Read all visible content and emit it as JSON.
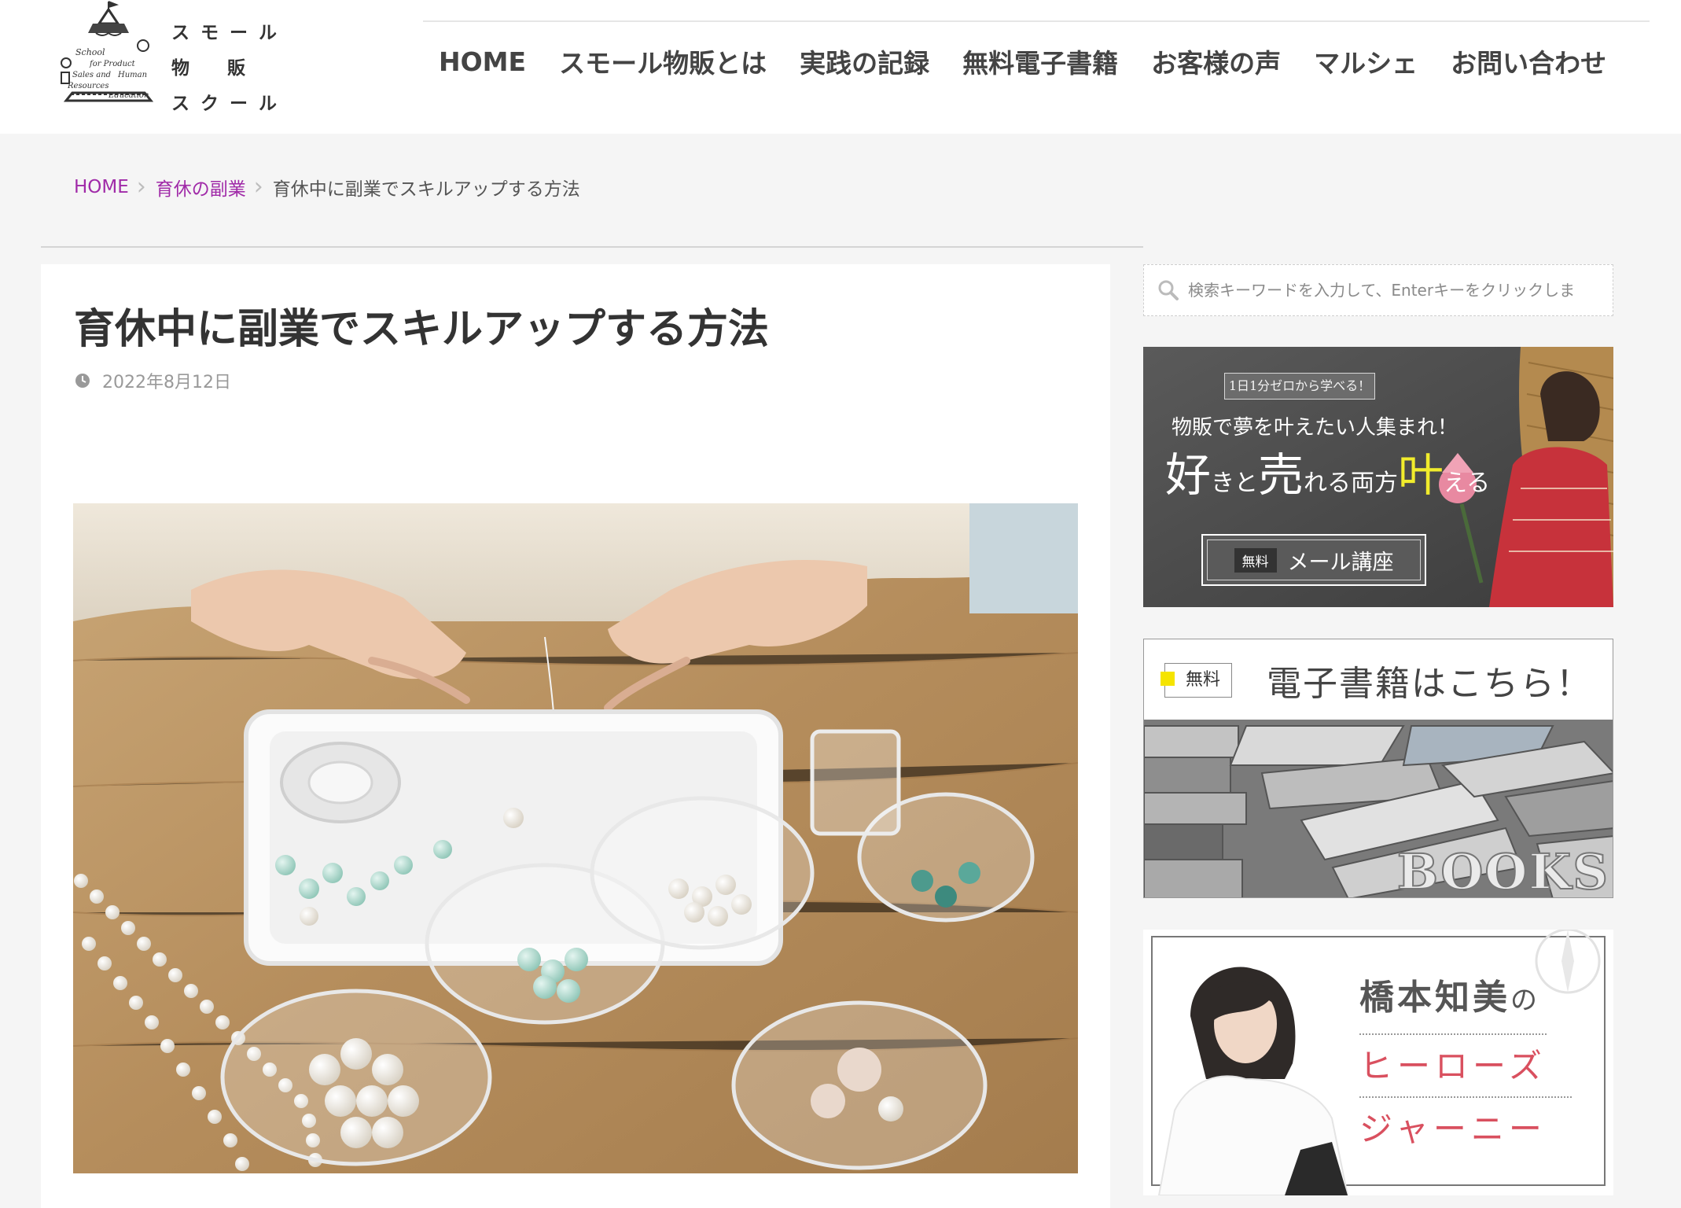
{
  "header": {
    "logo": {
      "line1": "スモール",
      "line2": "物販",
      "line3": "スクール",
      "script_text": "School for Product Sales and Human Resources Education"
    },
    "nav": [
      "HOME",
      "スモール物販とは",
      "実践の記録",
      "無料電子書籍",
      "お客様の声",
      "マルシェ",
      "お問い合わせ"
    ]
  },
  "breadcrumb": {
    "home": "HOME",
    "category": "育休の副業",
    "current": "育休中に副業でスキルアップする方法"
  },
  "article": {
    "title": "育休中に副業でスキルアップする方法",
    "date": "2022年8月12日",
    "date_icon": "clock-icon",
    "image": "hands stringing pearl beads over a white tray with glass bowls on a wooden table"
  },
  "sidebar": {
    "search": {
      "placeholder": "検索キーワードを入力して、Enterキーをクリックしま",
      "icon": "search-icon"
    },
    "mail_banner": {
      "tag": "1日1分ゼロから学べる！",
      "line1": "物販で夢を叶えたい人集まれ！",
      "big_a": "好",
      "small_a": "きと",
      "big_b": "売",
      "small_b": "れる",
      "small_c": "両方",
      "big_c": "叶",
      "small_d": "える",
      "free": "無料",
      "course": "メール講座"
    },
    "ebook_banner": {
      "free": "無料",
      "heading": "電子書籍はこちら！",
      "books": "BOOKS"
    },
    "heroes_banner": {
      "name": "橋本知美",
      "no": "の",
      "line1": "ヒーローズ",
      "line2": "ジャーニー"
    }
  },
  "colors": {
    "accent_link": "#a02aa8",
    "page_bg": "#f5f5f5",
    "title": "#333333",
    "banner_pink": "#d9505f",
    "highlight_yellow": "#f1ec2c"
  }
}
